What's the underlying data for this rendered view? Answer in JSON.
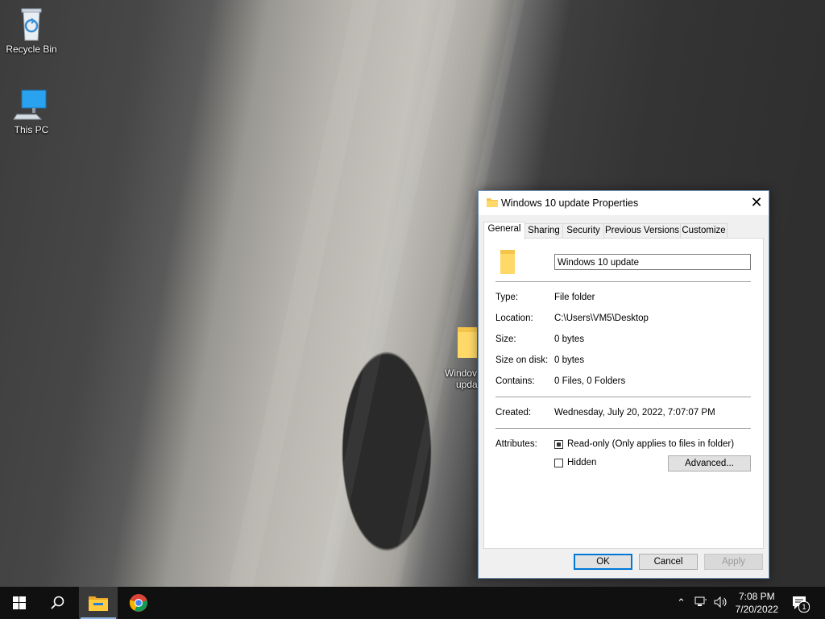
{
  "desktop": {
    "icons": [
      {
        "label": "Recycle Bin",
        "icon": "recycle-bin-icon"
      },
      {
        "label": "This PC",
        "icon": "computer-icon"
      },
      {
        "label": "Windows 10 update",
        "icon": "folder-icon"
      }
    ],
    "partial_folder_label_line1": "Windov",
    "partial_folder_label_line2": "upda"
  },
  "dialog": {
    "title": "Windows 10 update Properties",
    "tabs": [
      "General",
      "Sharing",
      "Security",
      "Previous Versions",
      "Customize"
    ],
    "active_tab": "General",
    "name_value": "Windows 10 update",
    "fields": {
      "type_label": "Type:",
      "type_value": "File folder",
      "location_label": "Location:",
      "location_value": "C:\\Users\\VM5\\Desktop",
      "size_label": "Size:",
      "size_value": "0 bytes",
      "size_on_disk_label": "Size on disk:",
      "size_on_disk_value": "0 bytes",
      "contains_label": "Contains:",
      "contains_value": "0 Files, 0 Folders",
      "created_label": "Created:",
      "created_value": "Wednesday, July 20, 2022, 7:07:07 PM",
      "attributes_label": "Attributes:"
    },
    "attributes": {
      "readonly_label": "Read-only (Only applies to files in folder)",
      "readonly_state": "indeterminate",
      "hidden_label": "Hidden",
      "hidden_checked": false,
      "advanced_label": "Advanced..."
    },
    "buttons": {
      "ok": "OK",
      "cancel": "Cancel",
      "apply": "Apply"
    },
    "close_glyph": "✕"
  },
  "taskbar": {
    "items": [
      "start-icon",
      "search-icon",
      "file-explorer-icon",
      "chrome-icon"
    ],
    "clock_time": "7:08 PM",
    "clock_date": "7/20/2022",
    "notification_count": "1",
    "colors": {
      "accent": "#0078d7",
      "taskbar": "#101010"
    }
  }
}
